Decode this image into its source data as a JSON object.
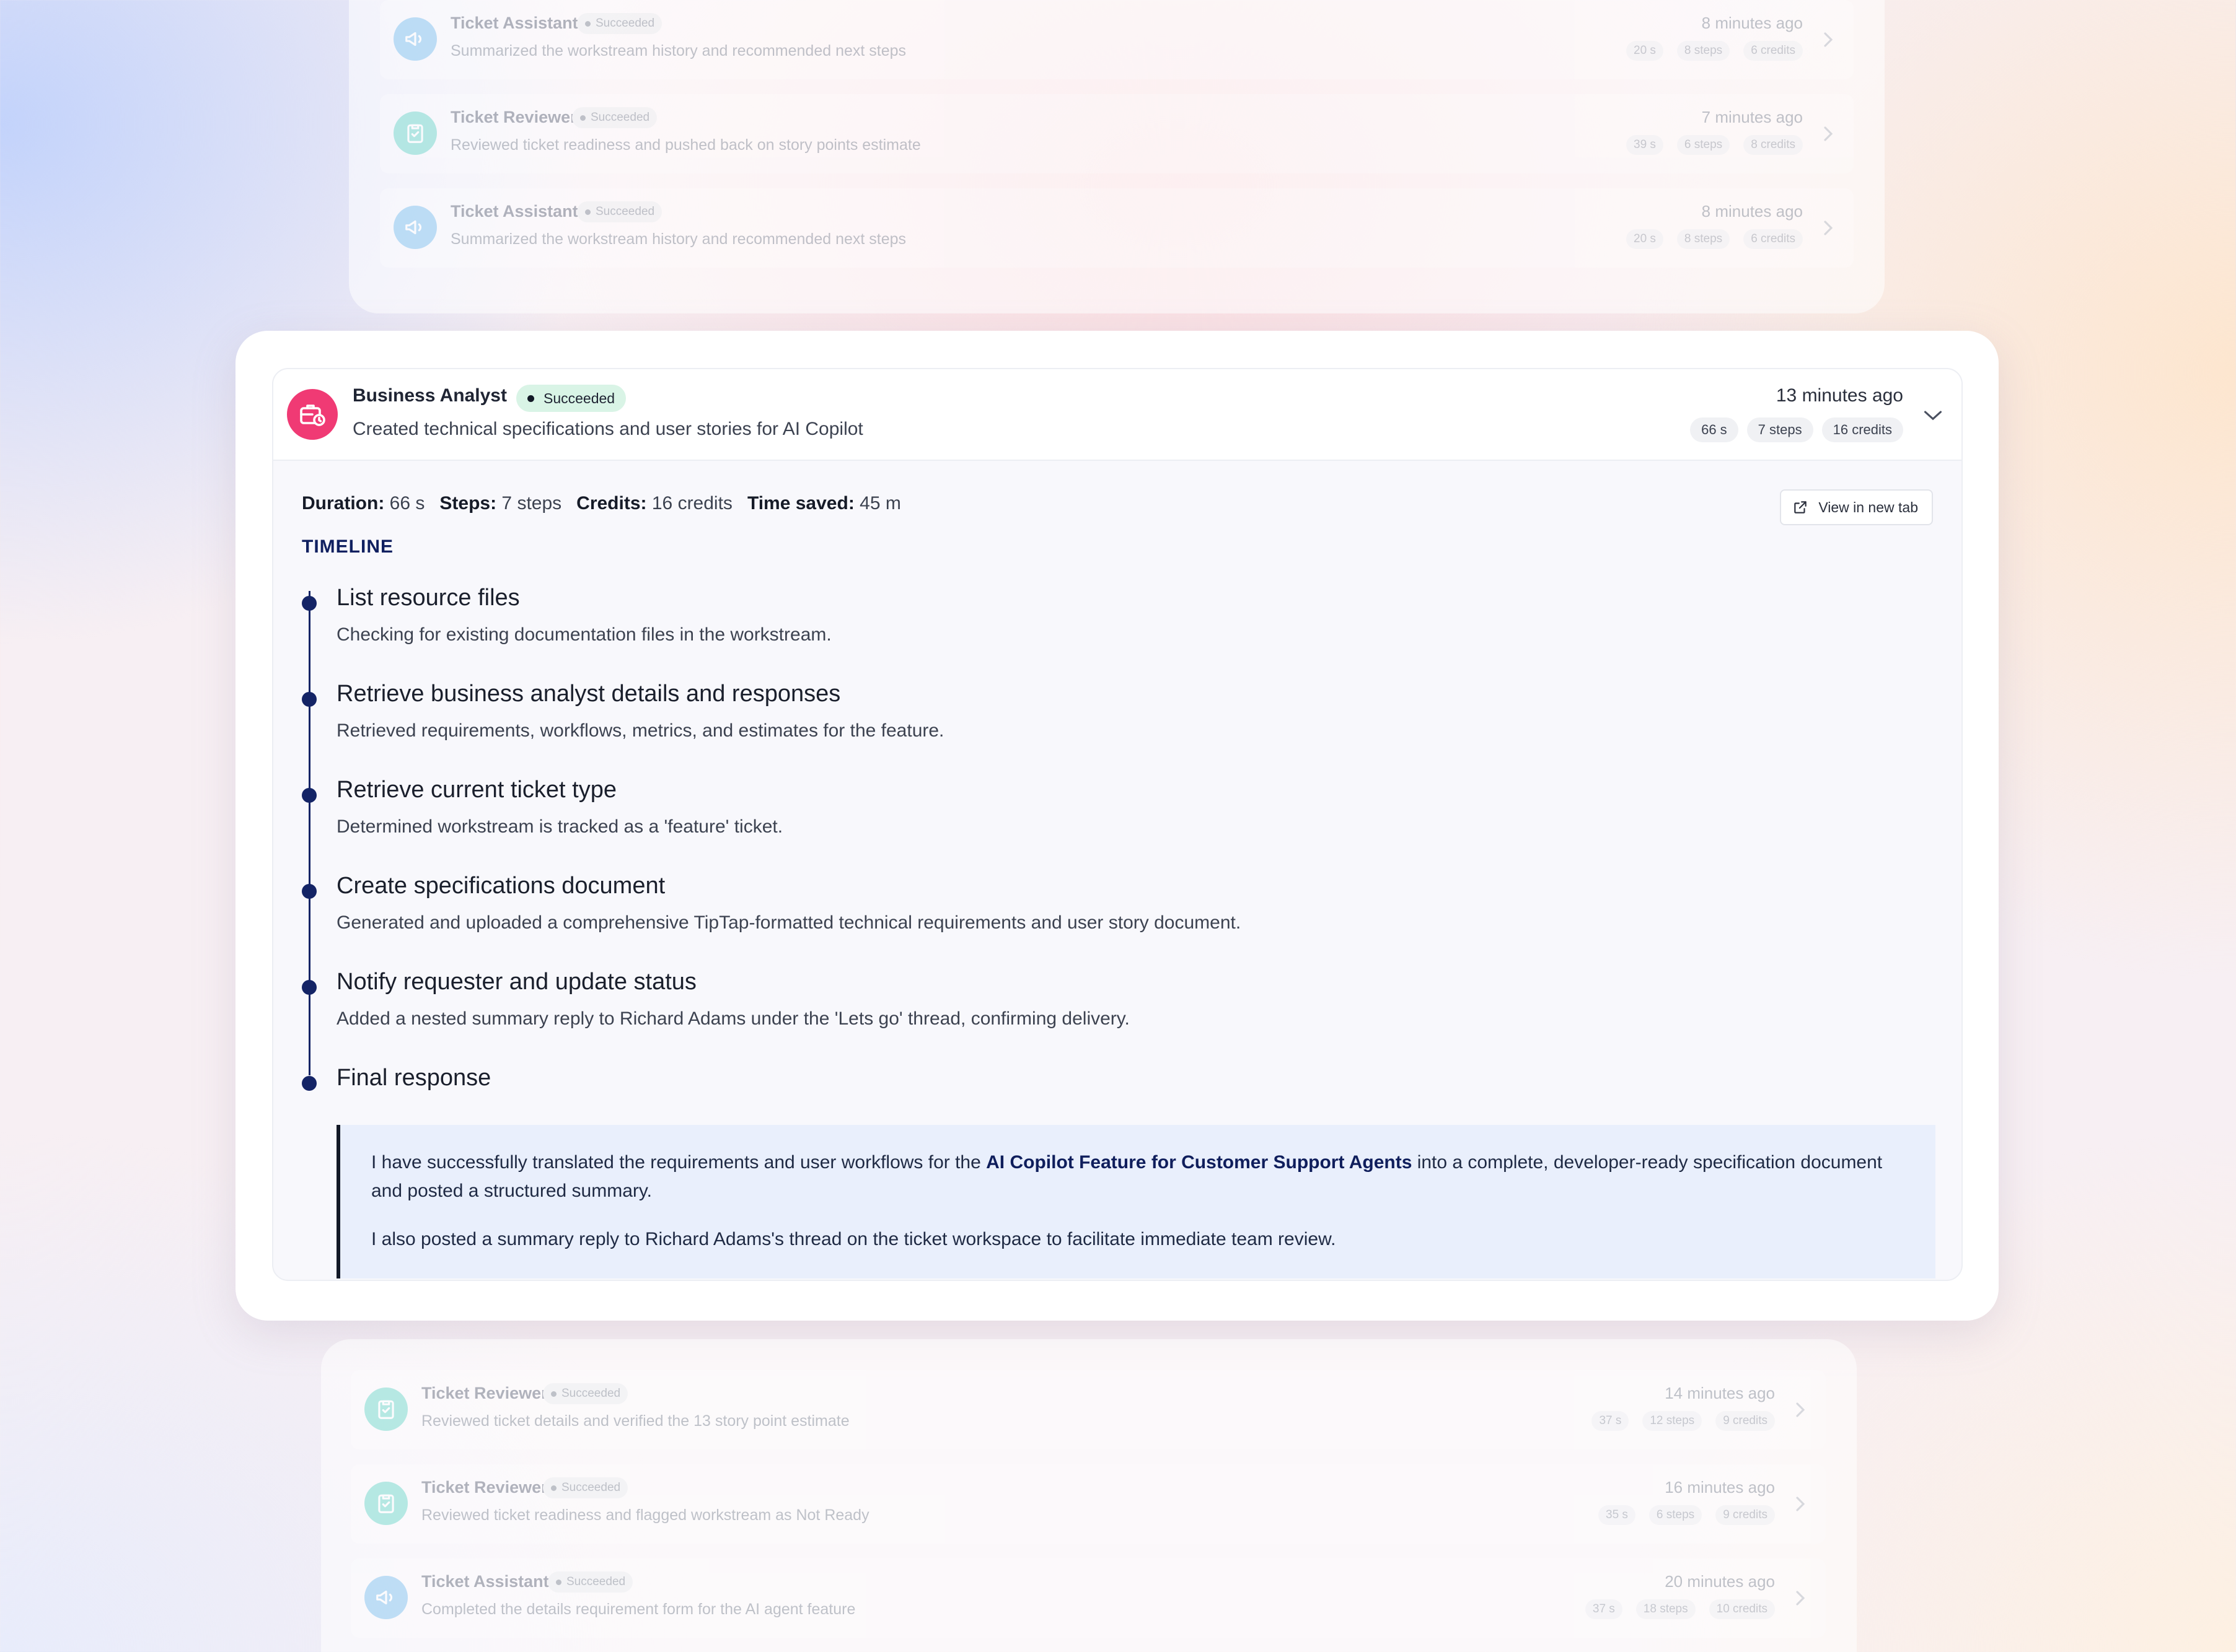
{
  "top_rows": [
    {
      "agent": "Ticket Assistant",
      "status": "Succeeded",
      "description": "Summarized the workstream history and recommended next steps",
      "time": "8 minutes ago",
      "duration": "20 s",
      "steps": "8 steps",
      "credits": "6 credits",
      "icon": "megaphone-icon",
      "color": "#8ec9f1"
    },
    {
      "agent": "Ticket Reviewer",
      "status": "Succeeded",
      "description": "Reviewed ticket readiness and pushed back on story points estimate",
      "time": "7 minutes ago",
      "duration": "39 s",
      "steps": "6 steps",
      "credits": "8 credits",
      "icon": "clipboard-check-icon",
      "color": "#7fdcd1"
    },
    {
      "agent": "Ticket Assistant",
      "status": "Succeeded",
      "description": "Summarized the workstream history and recommended next steps",
      "time": "8 minutes ago",
      "duration": "20 s",
      "steps": "8 steps",
      "credits": "6 credits",
      "icon": "megaphone-icon",
      "color": "#8ec9f1"
    }
  ],
  "main": {
    "agent": "Business Analyst",
    "status": "Succeeded",
    "description": "Created technical specifications and user stories for AI Copilot",
    "time": "13 minutes ago",
    "duration": "66 s",
    "steps": "7 steps",
    "credits": "16 credits",
    "icon": "briefcase-clock-icon",
    "color": "#f03a74",
    "stats": {
      "duration_label": "Duration:",
      "duration_value": "66 s",
      "steps_label": "Steps:",
      "steps_value": "7 steps",
      "credits_label": "Credits:",
      "credits_value": "16 credits",
      "time_saved_label": "Time saved:",
      "time_saved_value": "45 m"
    },
    "view_button": "View in new tab",
    "timeline_heading": "TIMELINE",
    "timeline": [
      {
        "title": "List resource files",
        "description": "Checking for existing documentation files in the workstream."
      },
      {
        "title": "Retrieve business analyst details and responses",
        "description": "Retrieved requirements, workflows, metrics, and estimates for the feature."
      },
      {
        "title": "Retrieve current ticket type",
        "description": "Determined workstream is tracked as a 'feature' ticket."
      },
      {
        "title": "Create specifications document",
        "description": "Generated and uploaded a comprehensive TipTap-formatted technical requirements and user story document."
      },
      {
        "title": "Notify requester and update status",
        "description": "Added a nested summary reply to Richard Adams under the 'Lets go' thread, confirming delivery."
      },
      {
        "title": "Final response",
        "description": ""
      }
    ],
    "final_response": {
      "p1_before": "I have successfully translated the requirements and user workflows for the ",
      "p1_bold": "AI Copilot Feature for Customer Support Agents",
      "p1_after": " into a complete, developer-ready specification document and posted a structured summary.",
      "p2": "I also posted a summary reply to Richard Adams's thread on the ticket workspace to facilitate immediate team review."
    }
  },
  "bottom_rows": [
    {
      "agent": "Ticket Reviewer",
      "status": "Succeeded",
      "description": "Reviewed ticket details and verified the 13 story point estimate",
      "time": "14 minutes ago",
      "duration": "37 s",
      "steps": "12 steps",
      "credits": "9 credits",
      "icon": "clipboard-check-icon",
      "color": "#7fdcd1"
    },
    {
      "agent": "Ticket Reviewer",
      "status": "Succeeded",
      "description": "Reviewed ticket readiness and flagged workstream as Not Ready",
      "time": "16 minutes ago",
      "duration": "35 s",
      "steps": "6 steps",
      "credits": "9 credits",
      "icon": "clipboard-check-icon",
      "color": "#7fdcd1"
    },
    {
      "agent": "Ticket Assistant",
      "status": "Succeeded",
      "description": "Completed the details requirement form for the AI agent feature",
      "time": "20 minutes ago",
      "duration": "37 s",
      "steps": "18 steps",
      "credits": "10 credits",
      "icon": "megaphone-icon",
      "color": "#8ec9f1"
    }
  ]
}
